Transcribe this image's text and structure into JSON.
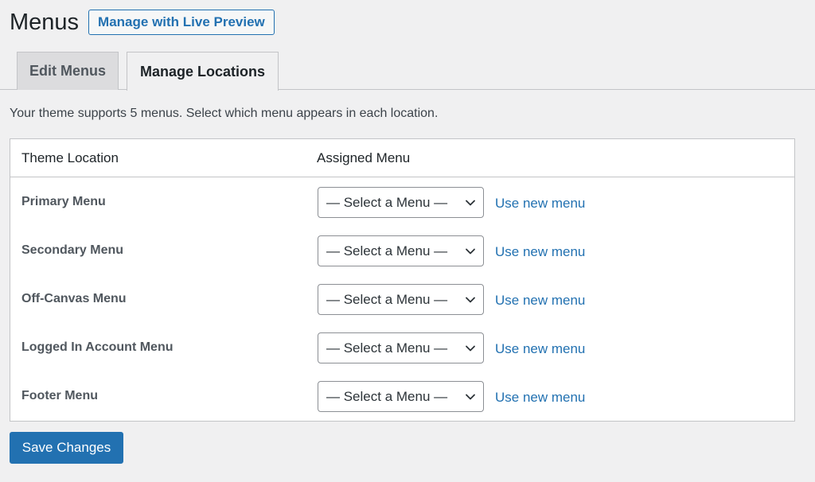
{
  "page": {
    "title": "Menus",
    "live_preview_label": "Manage with Live Preview"
  },
  "tabs": [
    {
      "label": "Edit Menus",
      "active": false
    },
    {
      "label": "Manage Locations",
      "active": true
    }
  ],
  "intro_text": "Your theme supports 5 menus. Select which menu appears in each location.",
  "table": {
    "headers": {
      "location": "Theme Location",
      "assigned": "Assigned Menu"
    },
    "rows": [
      {
        "location": "Primary Menu",
        "selected": "— Select a Menu —",
        "link": "Use new menu"
      },
      {
        "location": "Secondary Menu",
        "selected": "— Select a Menu —",
        "link": "Use new menu"
      },
      {
        "location": "Off-Canvas Menu",
        "selected": "— Select a Menu —",
        "link": "Use new menu"
      },
      {
        "location": "Logged In Account Menu",
        "selected": "— Select a Menu —",
        "link": "Use new menu"
      },
      {
        "location": "Footer Menu",
        "selected": "— Select a Menu —",
        "link": "Use new menu"
      }
    ]
  },
  "save_label": "Save Changes",
  "colors": {
    "accent": "#2271b1",
    "background": "#f0f0f1",
    "border": "#c3c4c7"
  }
}
